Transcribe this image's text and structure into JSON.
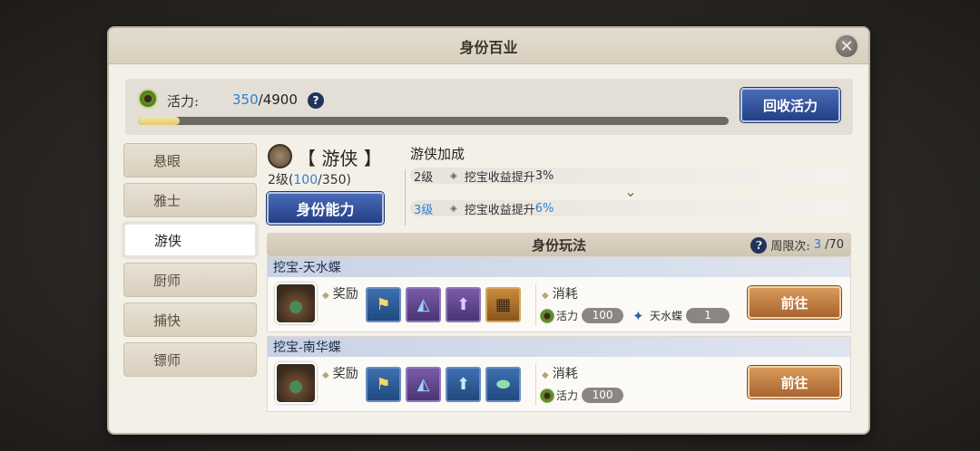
{
  "dialog": {
    "title": "身份百业",
    "close_icon": "close-icon"
  },
  "energy": {
    "label": "活力:",
    "current": "350",
    "max": "/4900",
    "progress": 0.0714,
    "recycle_button": "回收活力"
  },
  "help_glyph": "?",
  "sidebar": {
    "items": [
      {
        "label": "悬眼",
        "active": false
      },
      {
        "label": "雅士",
        "active": false
      },
      {
        "label": "游侠",
        "active": true
      },
      {
        "label": "厨师",
        "active": false
      },
      {
        "label": "捕快",
        "active": false
      },
      {
        "label": "镖师",
        "active": false
      }
    ]
  },
  "identity": {
    "name": "【 游侠 】",
    "level_prefix": "2级(",
    "exp_current": "100",
    "exp_suffix": "/350)",
    "ability_button": "身份能力"
  },
  "bonus": {
    "title": "游侠加成",
    "current": {
      "level": "2级",
      "text": "挖宝收益提升",
      "pct": "3%"
    },
    "next": {
      "level": "3级",
      "text": "挖宝收益提升",
      "pct": "6%"
    },
    "chevron": "⌄"
  },
  "play": {
    "title": "身份玩法",
    "weekly_label": "周限次:",
    "weekly_current": "3",
    "weekly_total": "/70"
  },
  "tasks": [
    {
      "name": "挖宝-天水蝶",
      "reward_label": "奖励",
      "cost_label": "消耗",
      "energy_cost_label": "活力",
      "energy_cost": "100",
      "item_cost_label": "天水蝶",
      "item_cost": "1",
      "go_button": "前往"
    },
    {
      "name": "挖宝-南华蝶",
      "reward_label": "奖励",
      "cost_label": "消耗",
      "energy_cost_label": "活力",
      "energy_cost": "100",
      "go_button": "前往"
    }
  ],
  "colors": {
    "accent_blue": "#2f7fd0",
    "button_blue": "#243f86",
    "button_orange": "#a86430"
  }
}
